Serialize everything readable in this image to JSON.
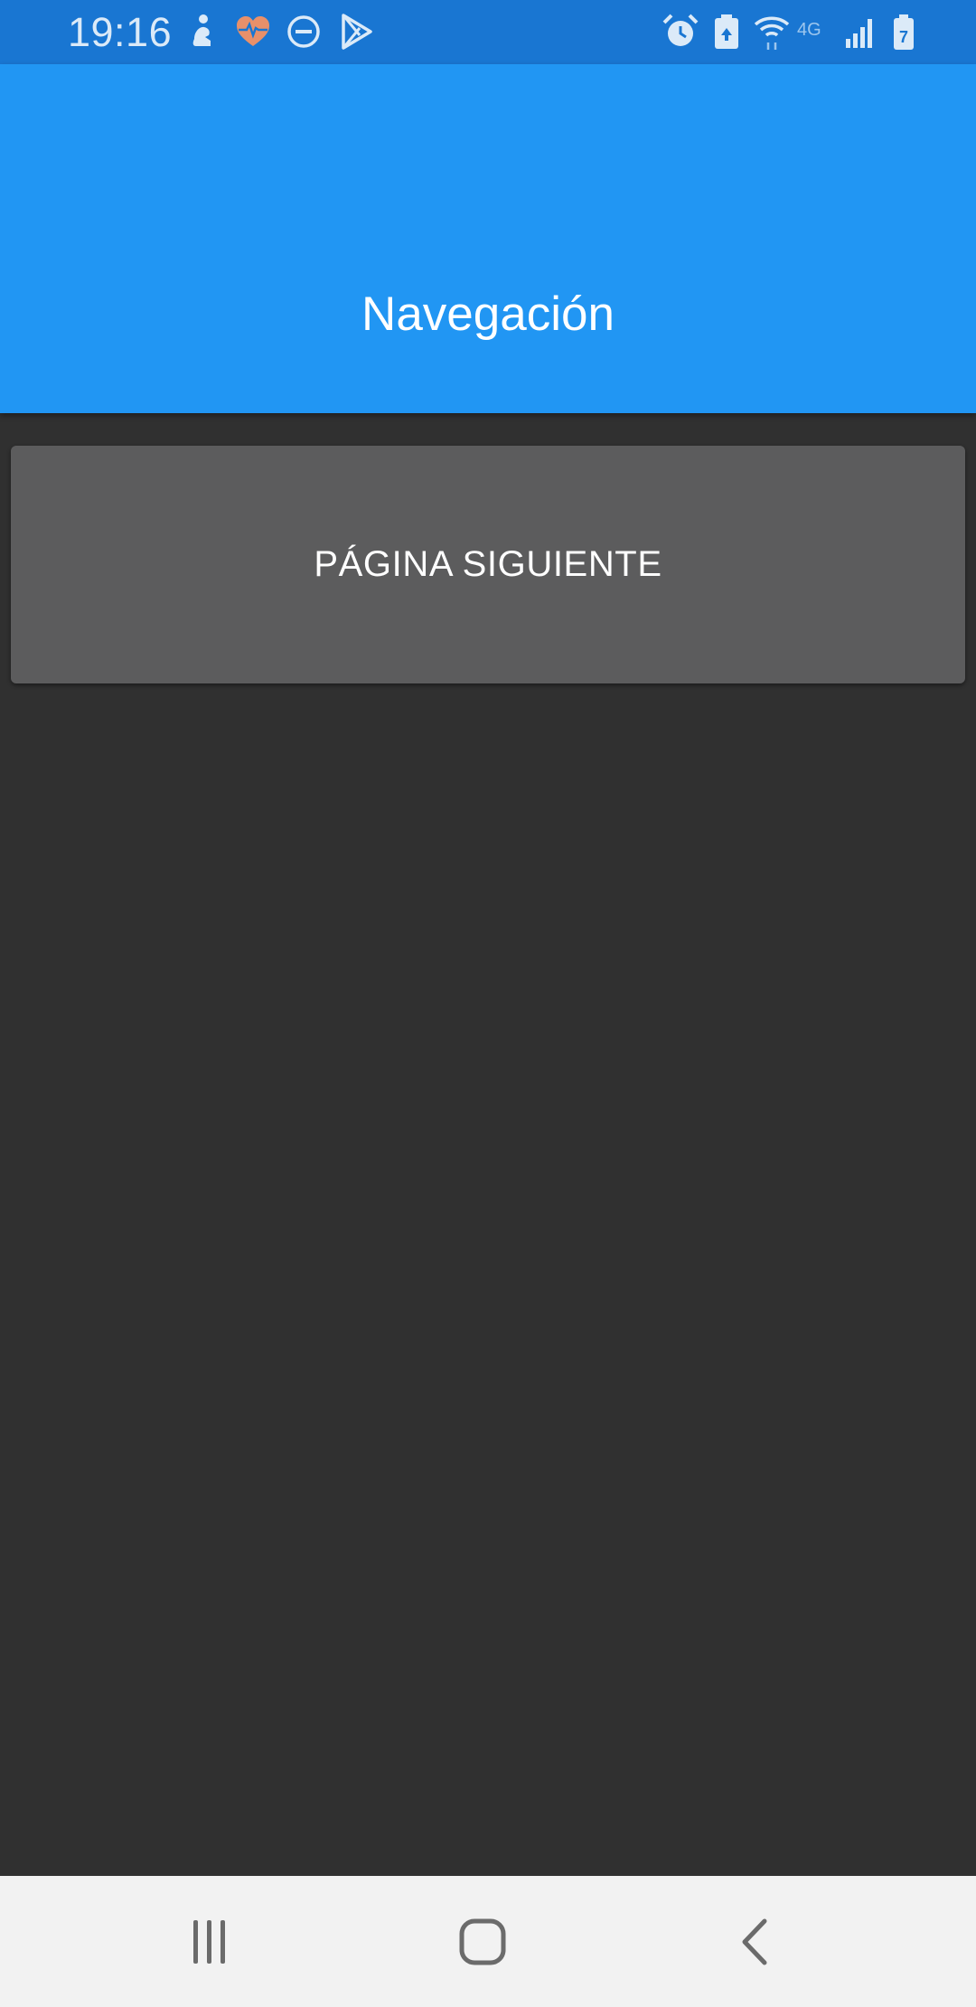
{
  "status_bar": {
    "time": "19:16",
    "network_label": "4G",
    "battery_level": "7",
    "left_icons": [
      "accessibility-icon",
      "health-heart-icon",
      "do-not-disturb-icon",
      "play-store-icon"
    ],
    "right_icons": [
      "alarm-icon",
      "battery-saver-icon",
      "wifi-icon",
      "network-4g-icon",
      "signal-icon",
      "battery-icon"
    ]
  },
  "app_bar": {
    "title": "Navegación",
    "color": "#2196F3"
  },
  "main": {
    "next_button_label": "PÁGINA SIGUIENTE",
    "background": "#303030"
  },
  "nav_bar": {
    "icons": [
      "recent-apps-icon",
      "home-icon",
      "back-icon"
    ]
  }
}
